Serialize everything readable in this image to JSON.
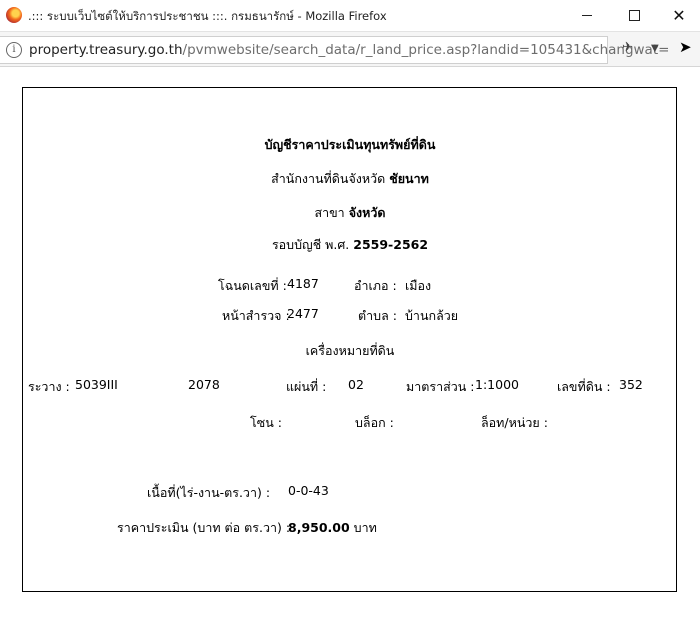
{
  "window": {
    "title": ".::: ระบบเว็บไซต์ให้บริการประชาชน :::. กรมธนารักษ์ - Mozilla Firefox"
  },
  "urlbar": {
    "host": "property.treasury.go.th",
    "path": "/pvmwebsite/search_data/r_land_price.asp?landid=105431&changwat="
  },
  "document": {
    "heading": "บัญชีราคาประเมินทุนทรัพย์ที่ดิน",
    "office_label": "สำนักงานที่ดินจังหวัด",
    "office_value": "ชัยนาท",
    "branch_label": "สาขา",
    "branch_value": "จังหวัด",
    "period_label": "รอบบัญชี พ.ศ.",
    "period_value": "2559-2562",
    "deed_label": "โฉนดเลขที่ :",
    "deed_value": "4187",
    "amphoe_label": "อำเภอ :",
    "amphoe_value": "เมือง",
    "survey_label": "หน้าสำรวจ :",
    "survey_value": "2477",
    "tambon_label": "ตำบล :",
    "tambon_value": "บ้านกล้วย",
    "landmark_heading": "เครื่องหมายที่ดิน",
    "rawang_label": "ระวาง :",
    "rawang_value": "5039III",
    "rawang_value2": "2078",
    "sheet_label": "แผ่นที่ :",
    "sheet_value": "02",
    "scale_label": "มาตราส่วน :",
    "scale_value": "1:1000",
    "landno_label": "เลขที่ดิน :",
    "landno_value": "352",
    "zone_label": "โซน :",
    "block_label": "บล็อก :",
    "lot_label": "ล็อท/หน่วย :",
    "area_label": "เนื้อที่(ไร่-งาน-ตร.วา) :",
    "area_value": "0-0-43",
    "price_label": "ราคาประเมิน (บาท ต่อ ตร.วา) :",
    "price_value": "8,950.00",
    "price_unit": "บาท"
  }
}
